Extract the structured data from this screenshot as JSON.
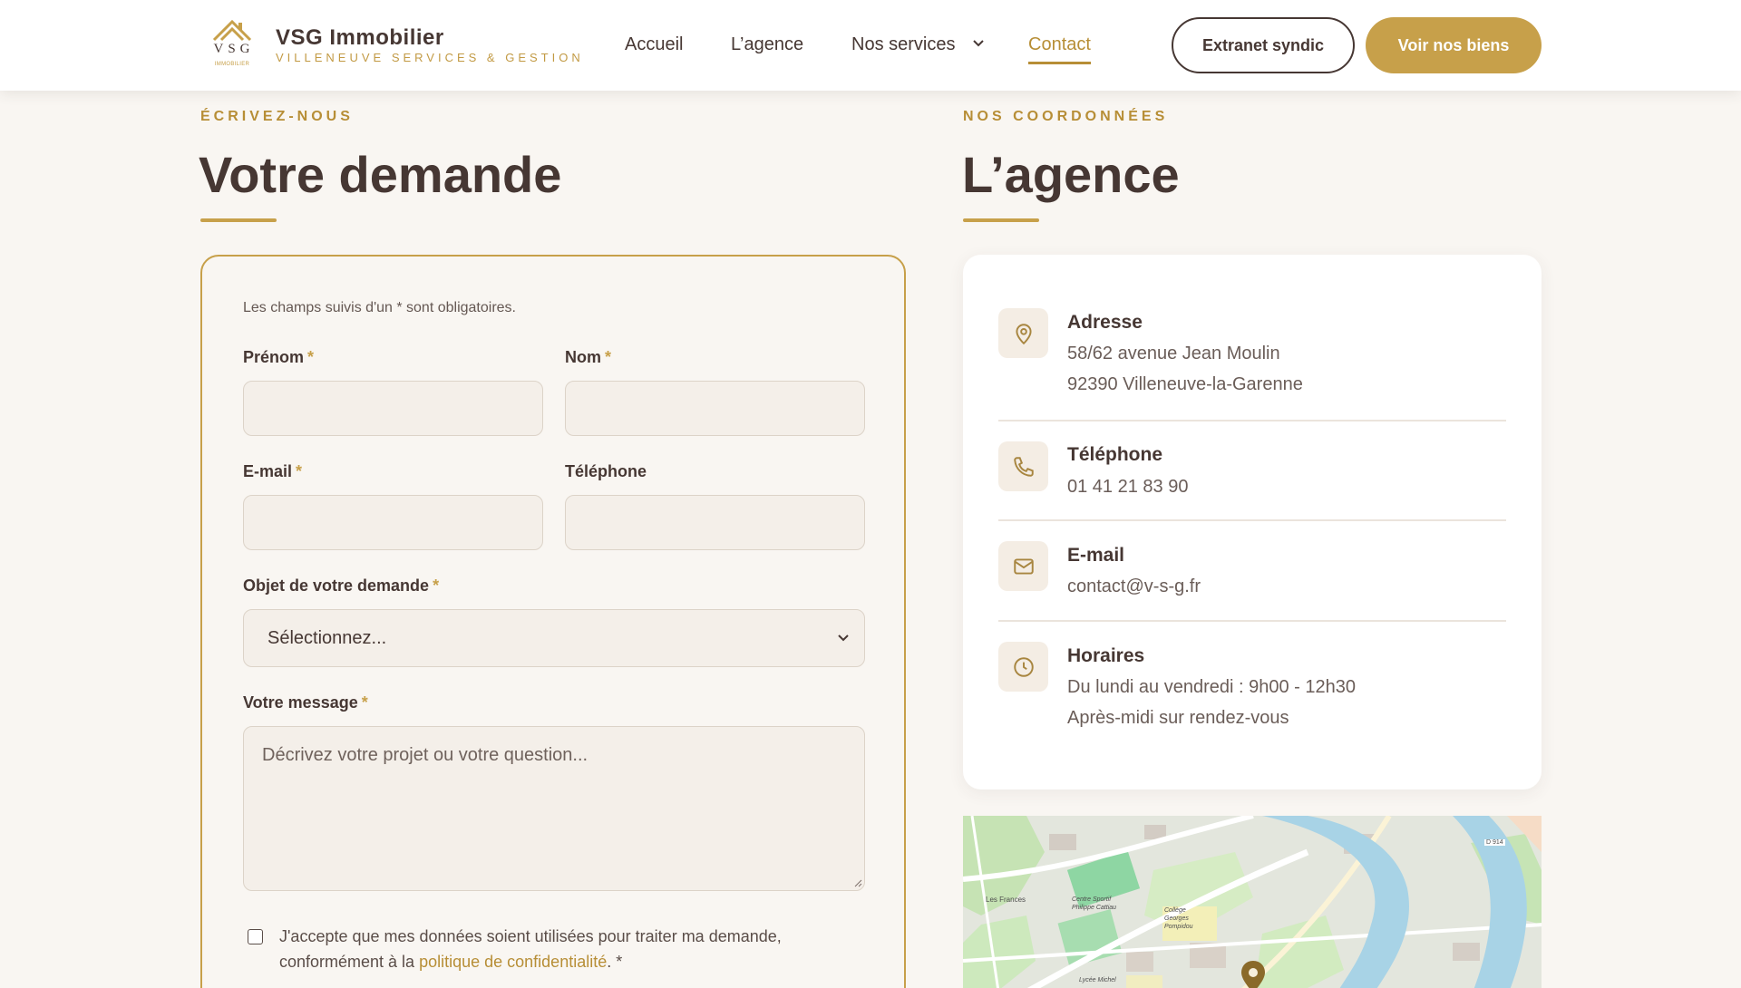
{
  "header": {
    "logo_text": "VSG",
    "logo_sub": "IMMOBILIER",
    "brand_name": "VSG Immobilier",
    "brand_tagline": "VILLENEUVE SERVICES & GESTION",
    "nav": [
      {
        "label": "Accueil"
      },
      {
        "label": "L’agence"
      },
      {
        "label": "Nos services"
      },
      {
        "label": "Contact"
      }
    ],
    "btn_extranet": "Extranet syndic",
    "btn_biens": "Voir nos biens"
  },
  "form_section": {
    "eyebrow": "ÉCRIVEZ-NOUS",
    "title": "Votre demande",
    "required_note": "Les champs suivis d'un * sont obligatoires.",
    "fields": {
      "prenom": {
        "label": "Prénom",
        "required": "*",
        "value": ""
      },
      "nom": {
        "label": "Nom",
        "required": "*",
        "value": ""
      },
      "email": {
        "label": "E-mail",
        "required": "*",
        "value": ""
      },
      "telephone": {
        "label": "Téléphone",
        "value": ""
      },
      "objet": {
        "label": "Objet de votre demande",
        "required": "*",
        "selected": "Sélectionnez..."
      },
      "message": {
        "label": "Votre message",
        "required": "*",
        "placeholder": "Décrivez votre projet ou votre question..."
      }
    },
    "consent": {
      "text_before": "J'accepte que mes données soient utilisées pour traiter ma demande, conformément à la ",
      "link": "politique de confidentialité",
      "text_after": ". *"
    }
  },
  "contact_section": {
    "eyebrow": "NOS COORDONNÉES",
    "title": "L’agence",
    "address": {
      "title": "Adresse",
      "line1": "58/62 avenue Jean Moulin",
      "line2": "92390 Villeneuve-la-Garenne"
    },
    "phone": {
      "title": "Téléphone",
      "value": "01 41 21 83 90"
    },
    "email": {
      "title": "E-mail",
      "value": "contact@v-s-g.fr"
    },
    "hours": {
      "title": "Horaires",
      "line1": "Du lundi au vendredi : 9h00 - 12h30",
      "line2": "Après-midi sur rendez-vous"
    }
  },
  "map": {
    "labels": [
      "Les Frances",
      "Centre Sportif Philippe Cattiau",
      "Collège Georges Pompidou",
      "Lycée Michel",
      "D 914"
    ]
  },
  "colors": {
    "accent": "#c7a04a",
    "text": "#463733",
    "background": "#f9f6f2",
    "input_bg": "#f4efe9"
  }
}
